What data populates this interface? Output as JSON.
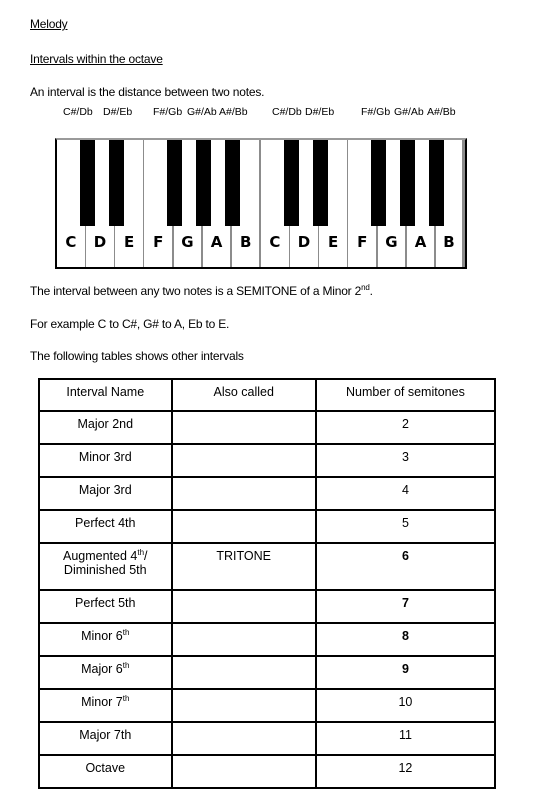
{
  "title": "Melody",
  "subtitle": "Intervals within the octave",
  "intro": "An interval is the distance between two notes.",
  "sharp_labels": [
    "C#/Db",
    "D#/Eb",
    "F#/Gb",
    "G#/Ab",
    "A#/Bb",
    "C#/Db",
    "D#/Eb",
    "F#/Gb",
    "G#/Ab",
    "A#/Bb"
  ],
  "keyboard": {
    "white_keys": [
      "C",
      "D",
      "E",
      "F",
      "G",
      "A",
      "B",
      "C",
      "D",
      "E",
      "F",
      "G",
      "A",
      "B"
    ],
    "black_key_after_white_index": [
      0,
      1,
      3,
      4,
      5,
      7,
      8,
      10,
      11,
      12
    ]
  },
  "semitone_line": {
    "text": "The interval between any two notes is a SEMITONE of a Minor 2",
    "sup": "nd",
    "end": "."
  },
  "example_line": "For example C to C#, G# to A, Eb to E.",
  "table_intro": "The following tables shows other intervals",
  "table": {
    "headers": [
      "Interval Name",
      "Also called",
      "Number of semitones"
    ],
    "rows": [
      {
        "name": "Major 2nd",
        "sup": "",
        "name2": "",
        "also": "",
        "semitones": "2"
      },
      {
        "name": "Minor 3rd",
        "sup": "",
        "name2": "",
        "also": "",
        "semitones": "3"
      },
      {
        "name": "Major 3rd",
        "sup": "",
        "name2": "",
        "also": "",
        "semitones": "4"
      },
      {
        "name": "Perfect 4th",
        "sup": "",
        "name2": "",
        "also": "",
        "semitones": "5"
      },
      {
        "name": "Augmented 4",
        "sup": "th",
        "name2": "/ Diminished 5th",
        "also": "TRITONE",
        "semitones": "6"
      },
      {
        "name": "Perfect 5th",
        "sup": "",
        "name2": "",
        "also": "",
        "semitones": "7"
      },
      {
        "name": "Minor 6",
        "sup": "th",
        "name2": "",
        "also": "",
        "semitones": "8"
      },
      {
        "name": "Major 6",
        "sup": "th",
        "name2": "",
        "also": "",
        "semitones": "9"
      },
      {
        "name": "Minor 7",
        "sup": "th",
        "name2": "",
        "also": "",
        "semitones": "10"
      },
      {
        "name": "Major 7th",
        "sup": "",
        "name2": "",
        "also": "",
        "semitones": "11"
      },
      {
        "name": "Octave",
        "sup": "",
        "name2": "",
        "also": "",
        "semitones": "12"
      }
    ]
  }
}
